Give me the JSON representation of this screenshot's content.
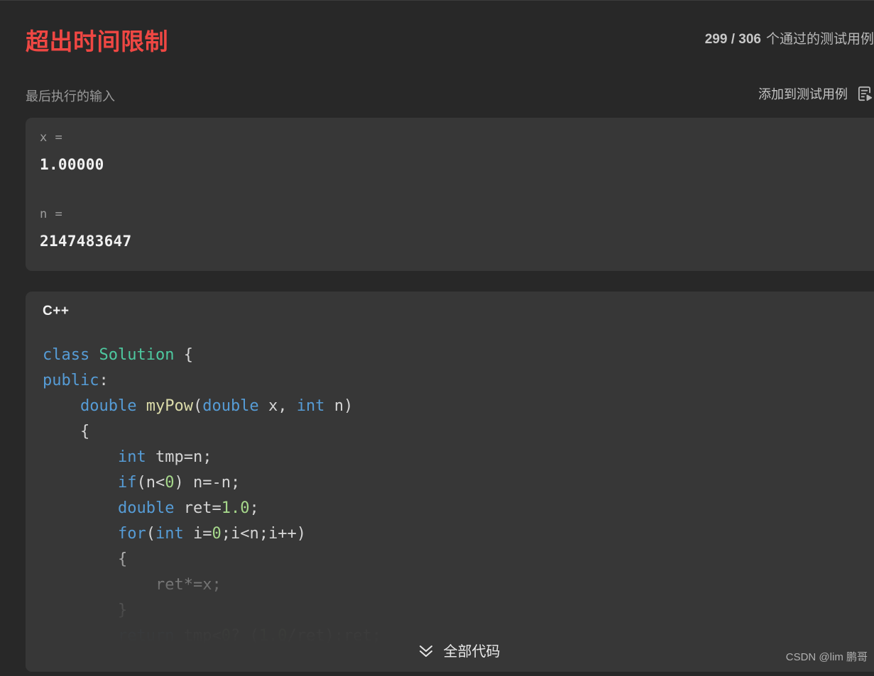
{
  "result": {
    "verdict": "超出时间限制",
    "verdict_color": "#ef4743",
    "testcases_passed": "299 / 306",
    "testcases_suffix": "个通过的测试用例",
    "last_input_label": "最后执行的输入",
    "add_testcase_label": "添加到测试用例",
    "add_testcase_icon": "file-play-icon"
  },
  "last_input": {
    "fields": [
      {
        "key": "x =",
        "value": "1.00000"
      },
      {
        "key": "n =",
        "value": "2147483647"
      }
    ]
  },
  "code": {
    "language": "C++",
    "expand_label": "全部代码",
    "expand_icon": "chevron-double-down-icon",
    "lines": [
      "class Solution {",
      "public:",
      "    double myPow(double x, int n)",
      "    {",
      "        int tmp=n;",
      "        if(n<0) n=-n;",
      "        double ret=1.0;",
      "        for(int i=0;i<n;i++)",
      "        {",
      "            ret*=x;",
      "        }",
      "        return tmp<0? (1.0/ret):ret;"
    ],
    "theme": {
      "keyword": "#569cd6",
      "class_name": "#4ec9a0",
      "function": "#dcdcaa",
      "number": "#a6d88b",
      "plain": "#d4d4d4",
      "panel_bg": "#373737"
    }
  },
  "watermark": {
    "text": "CSDN @lim 鹏哥"
  },
  "theme": {
    "page_bg": "#282828",
    "panel_bg": "#373737",
    "text_primary": "#f0f0f0",
    "text_muted": "#9a9a9a"
  }
}
